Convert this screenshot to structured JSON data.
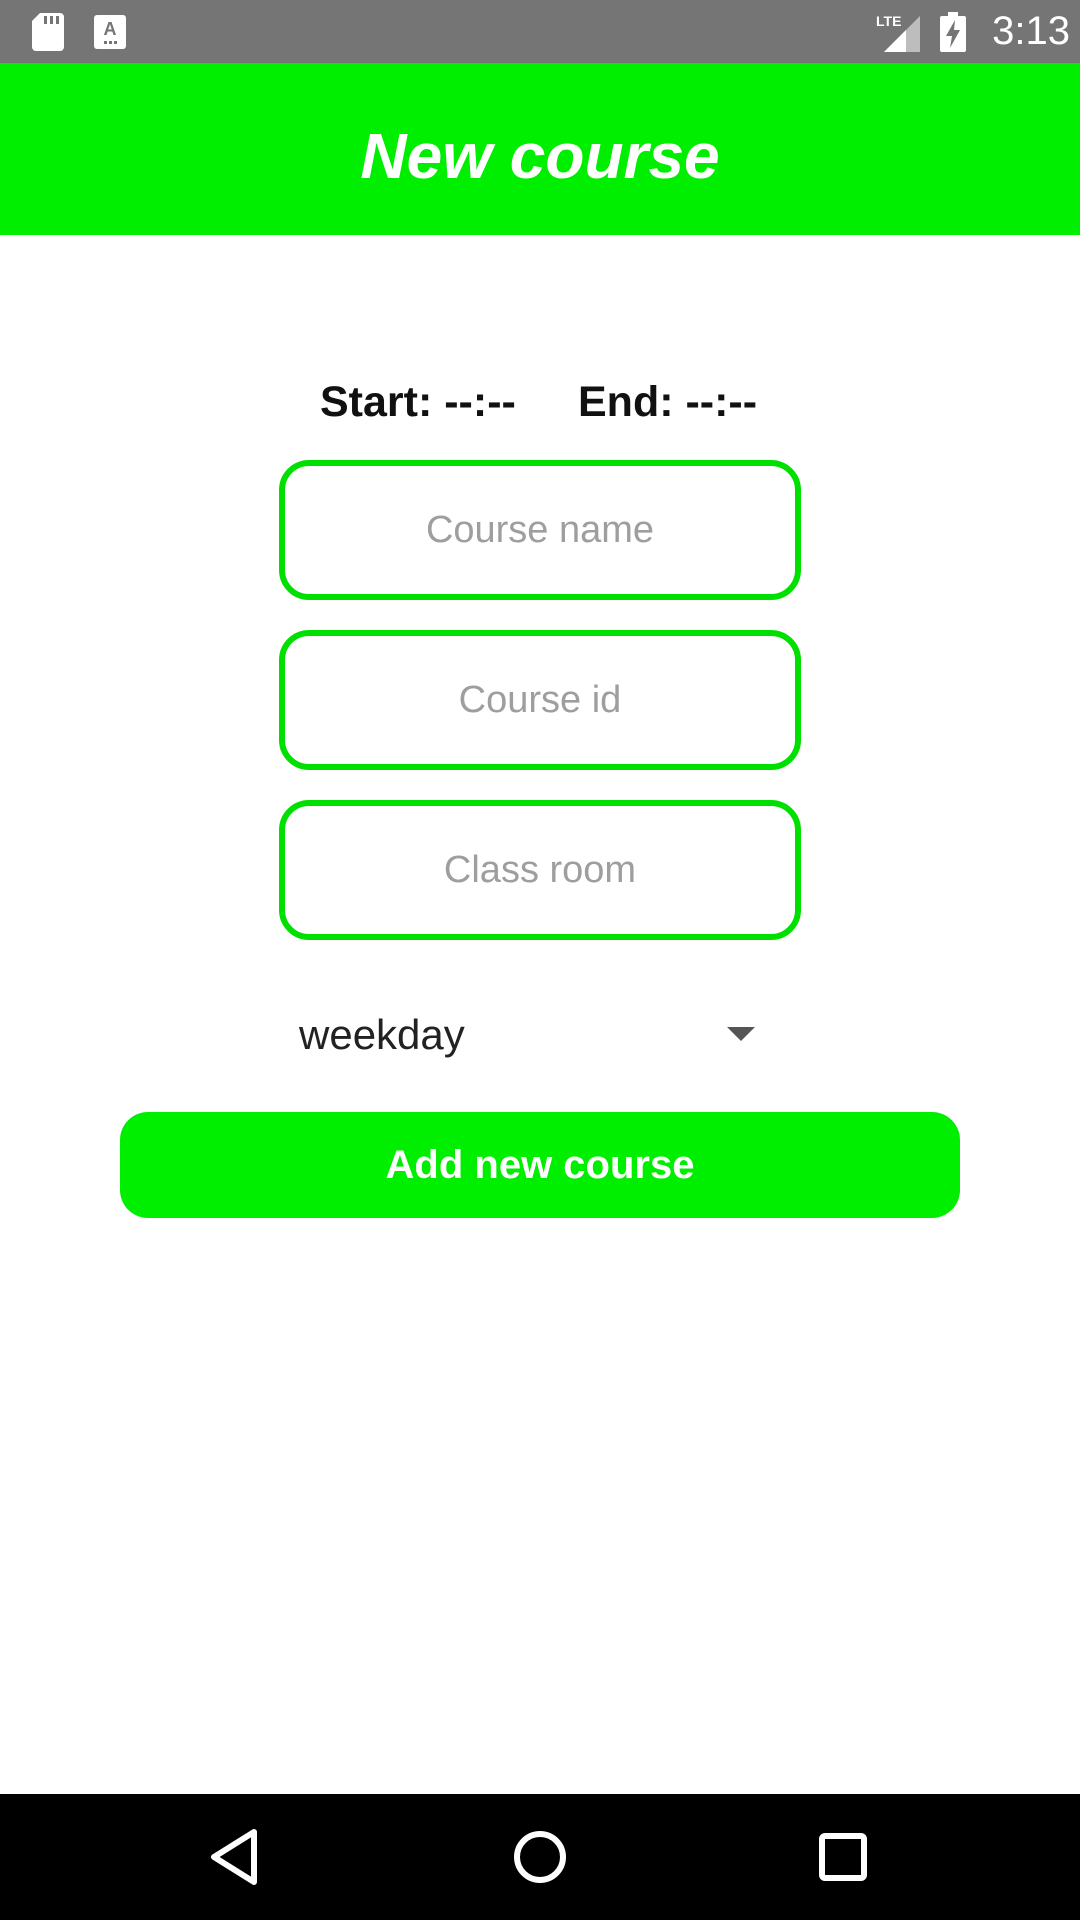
{
  "status_bar": {
    "time": "3:13",
    "icons": [
      "sd-card-icon",
      "keyboard-icon",
      "lte-signal-icon",
      "battery-charging-icon"
    ],
    "network_label": "LTE"
  },
  "app_bar": {
    "title": "New course",
    "color": "#00ee00"
  },
  "form": {
    "start_time": "Start: --:--",
    "end_time": "End: --:--",
    "course_name_placeholder": "Course name",
    "course_id_placeholder": "Course id",
    "class_room_placeholder": "Class room",
    "weekday_value": "weekday",
    "submit_label": "Add new course",
    "accent_color": "#00e000"
  },
  "nav_bar": {
    "buttons": [
      "back-icon",
      "home-icon",
      "recents-icon"
    ]
  }
}
